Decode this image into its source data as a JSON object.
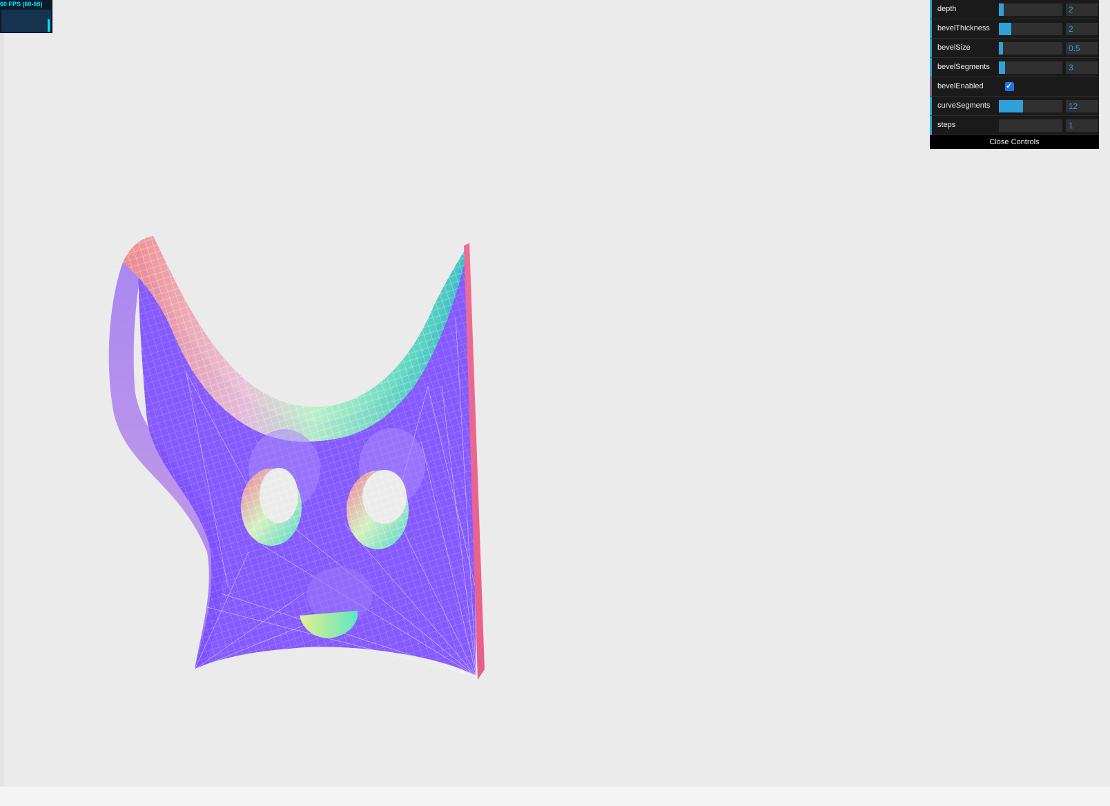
{
  "stats": {
    "fps_text": "60 FPS (60-60)",
    "fps_level": 0.55
  },
  "gui": {
    "controls": [
      {
        "label": "depth",
        "value": "2",
        "fill": 0.08
      },
      {
        "label": "bevelThickness",
        "value": "2",
        "fill": 0.2
      },
      {
        "label": "bevelSize",
        "value": "0.5",
        "fill": 0.05
      },
      {
        "label": "bevelSegments",
        "value": "3",
        "fill": 0.1
      },
      {
        "label": "bevelEnabled",
        "checked": true
      },
      {
        "label": "curveSegments",
        "value": "12",
        "fill": 0.38
      },
      {
        "label": "steps",
        "value": "1",
        "fill": 0.0
      }
    ],
    "close_label": "Close Controls"
  },
  "colors": {
    "accent": "#2fa1d6",
    "panel_bg": "#1a1a1a",
    "mesh_face": "#7c4dff",
    "page_bg": "#ebebeb",
    "fps": "#00e5ff"
  }
}
